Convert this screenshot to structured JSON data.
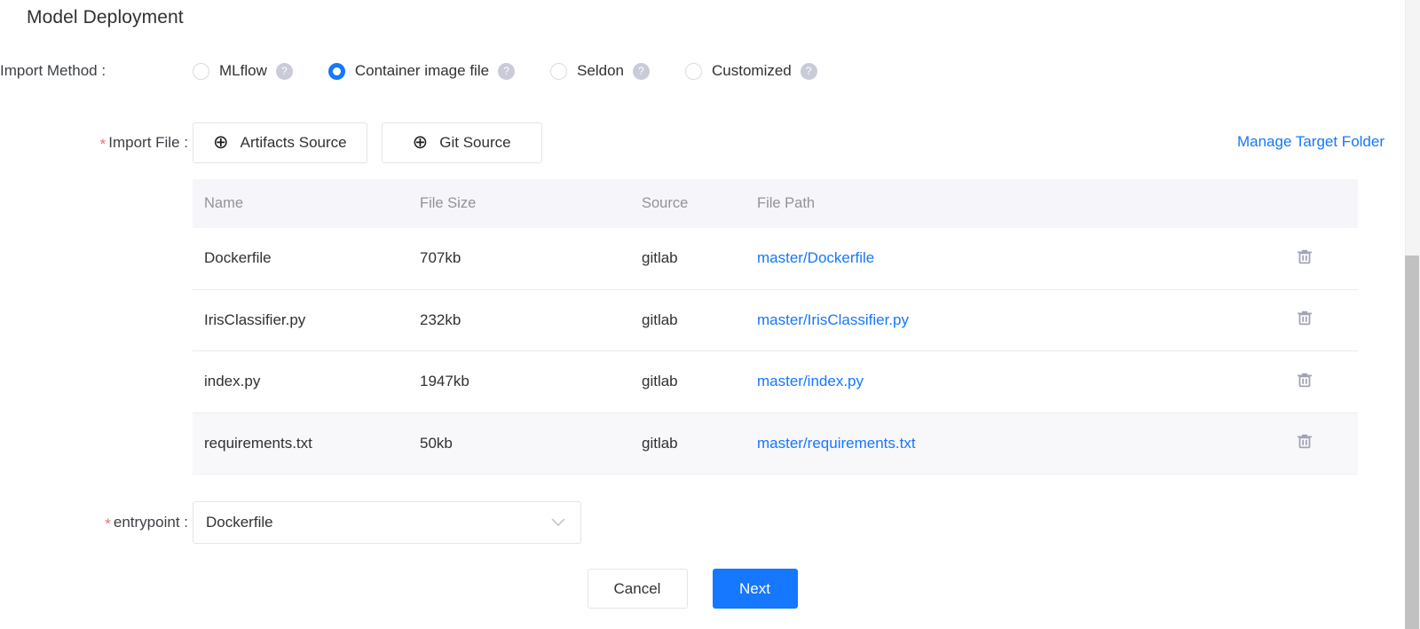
{
  "page": {
    "title": "Model Deployment"
  },
  "import_method": {
    "label": "Import Method :",
    "help_icon": "question-mark-icon",
    "options": [
      {
        "label": "MLflow",
        "selected": false
      },
      {
        "label": "Container image file",
        "selected": true
      },
      {
        "label": "Seldon",
        "selected": false
      },
      {
        "label": "Customized",
        "selected": false
      }
    ]
  },
  "import_file": {
    "required": "*",
    "label": "Import File :",
    "buttons": [
      {
        "label": "Artifacts Source",
        "icon": "plus-circle-icon"
      },
      {
        "label": "Git Source",
        "icon": "plus-circle-icon"
      }
    ],
    "manage_link": "Manage Target Folder"
  },
  "table": {
    "columns": [
      "Name",
      "File Size",
      "Source",
      "File Path"
    ],
    "delete_icon": "trash-icon",
    "rows": [
      {
        "name": "Dockerfile",
        "size": "707kb",
        "source": "gitlab",
        "path": "master/Dockerfile",
        "shaded": false
      },
      {
        "name": "IrisClassifier.py",
        "size": "232kb",
        "source": "gitlab",
        "path": "master/IrisClassifier.py",
        "shaded": false
      },
      {
        "name": "index.py",
        "size": "1947kb",
        "source": "gitlab",
        "path": "master/index.py",
        "shaded": false
      },
      {
        "name": "requirements.txt",
        "size": "50kb",
        "source": "gitlab",
        "path": "master/requirements.txt",
        "shaded": true
      }
    ]
  },
  "entrypoint": {
    "required": "*",
    "label": "entrypoint :",
    "value": "Dockerfile",
    "chevron_icon": "chevron-down-icon"
  },
  "footer": {
    "cancel_label": "Cancel",
    "next_label": "Next"
  },
  "colors": {
    "accent": "#1677ff",
    "link": "#1677ff",
    "required_star": "#f56c6c",
    "header_bg": "#f6f6fa",
    "help_icon_bg": "#c9cbd8",
    "trash": "#a0a3b5"
  }
}
